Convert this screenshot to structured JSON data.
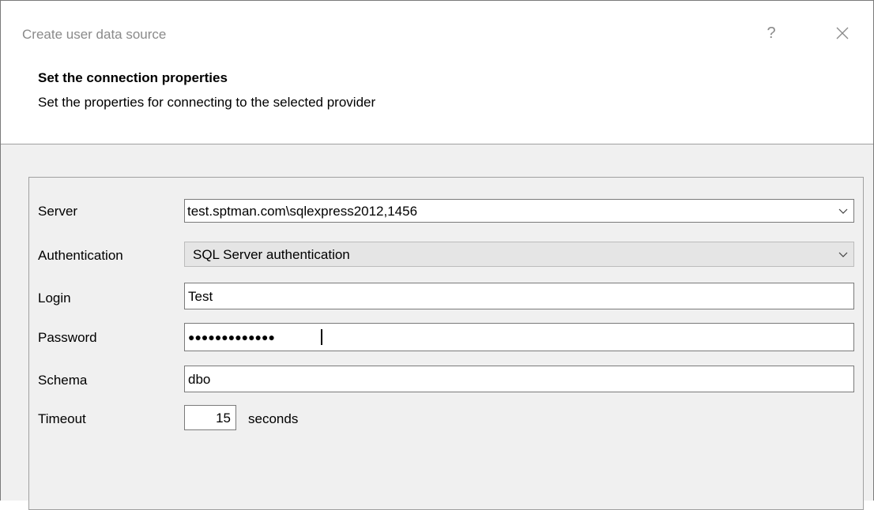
{
  "window": {
    "title": "Create user data source",
    "help_label": "?"
  },
  "header": {
    "title": "Set the connection properties",
    "subtitle": "Set the properties for connecting to the selected provider"
  },
  "form": {
    "server": {
      "label": "Server",
      "value": "test.sptman.com\\sqlexpress2012,1456"
    },
    "authentication": {
      "label": "Authentication",
      "value": "SQL Server authentication"
    },
    "login": {
      "label": "Login",
      "value": "Test"
    },
    "password": {
      "label": "Password",
      "masked_value": "●●●●●●●●●●●●●"
    },
    "schema": {
      "label": "Schema",
      "value": "dbo"
    },
    "timeout": {
      "label": "Timeout",
      "value": "15",
      "unit": "seconds"
    }
  },
  "icons": {
    "close": "close-icon",
    "dropdown": "chevron-down-icon"
  },
  "colors": {
    "title_text": "#8a8a8a",
    "body_background": "#f0f0f0",
    "disabled_combo": "#e5e5e5"
  }
}
